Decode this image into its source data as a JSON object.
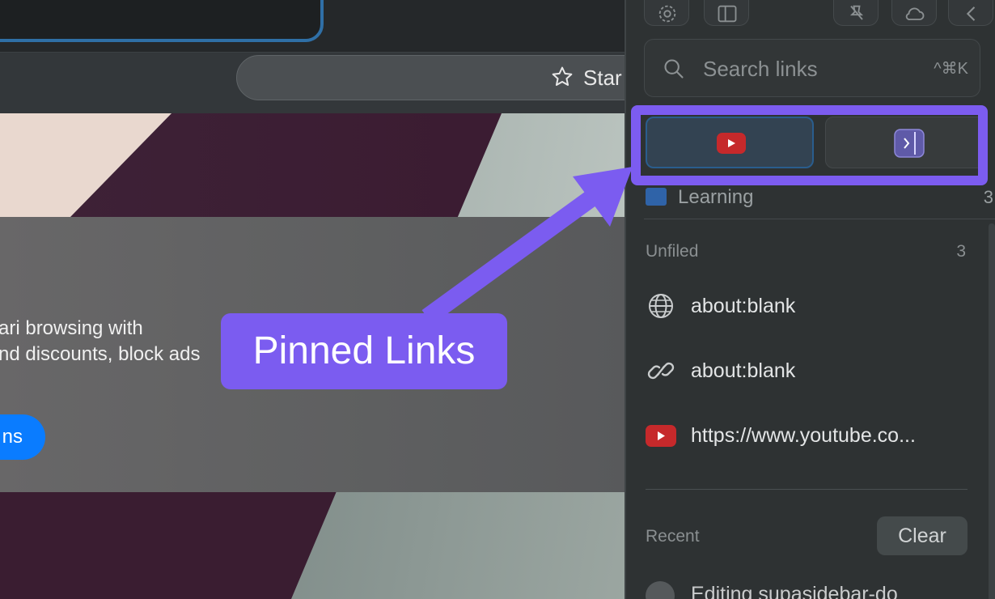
{
  "browser": {
    "toolbar_item_label": "Star",
    "banner": {
      "line1": "ari browsing with",
      "line2": "nd discounts, block ads",
      "button_label": "ns"
    }
  },
  "sidebar": {
    "search": {
      "placeholder": "Search links",
      "shortcut": "^⌘K"
    },
    "pinned": [
      {
        "icon": "youtube-icon"
      },
      {
        "icon": "sidebar-toggle-icon"
      }
    ],
    "folder": {
      "label": "Learning",
      "count": "3"
    },
    "unfiled": {
      "title": "Unfiled",
      "count": "3",
      "items": [
        {
          "icon": "globe-icon",
          "label": "about:blank"
        },
        {
          "icon": "link-icon",
          "label": "about:blank"
        },
        {
          "icon": "youtube-icon",
          "label": "https://www.youtube.co..."
        }
      ]
    },
    "recent": {
      "title": "Recent",
      "clear_label": "Clear",
      "items": [
        {
          "icon": "github-icon",
          "label": "Editing supasidebar-do"
        }
      ]
    }
  },
  "annotation": {
    "callout_label": "Pinned Links",
    "accent_color": "#7b5cf0"
  },
  "colors": {
    "sidebar_bg": "#2e3233",
    "youtube_red": "#d32f2f",
    "pinned_active_border": "#2a5d8d"
  }
}
